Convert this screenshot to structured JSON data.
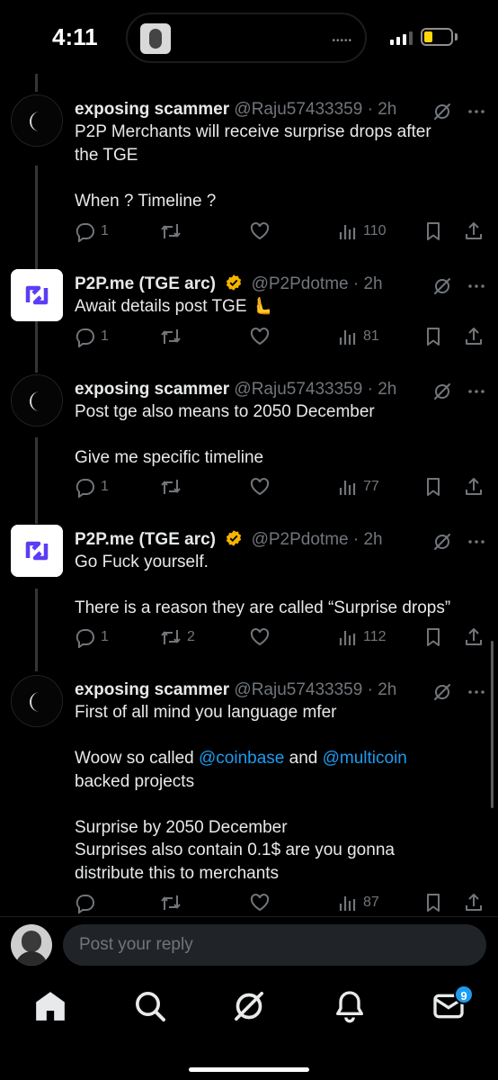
{
  "status_bar": {
    "time": "4:11",
    "island_dots": "•••••"
  },
  "thread": {
    "tweets": [
      {
        "author": "exposing scammer",
        "handle": "@Raju57433359",
        "time": "· 2h",
        "verified": false,
        "avatar": "moon-avatar",
        "lines": [
          "P2P Merchants will receive surprise drops after",
          "the TGE",
          "",
          "When ? Timeline ?"
        ],
        "replies": "1",
        "retweets": "",
        "views": "110"
      },
      {
        "author": "P2P.me (TGE arc)",
        "handle": "@P2Pdotme",
        "time": "· 2h",
        "verified": true,
        "avatar": "p2p-logo",
        "lines": [
          "Await details post TGE 🫷"
        ],
        "replies": "1",
        "retweets": "",
        "views": "81"
      },
      {
        "author": "exposing scammer",
        "handle": "@Raju57433359",
        "time": "· 2h",
        "verified": false,
        "avatar": "moon-avatar",
        "lines": [
          "Post tge also means to 2050 December",
          "",
          "Give me specific timeline"
        ],
        "replies": "1",
        "retweets": "",
        "views": "77"
      },
      {
        "author": "P2P.me (TGE arc)",
        "handle": "@P2Pdotme",
        "time": "· 2h",
        "verified": true,
        "avatar": "p2p-logo",
        "lines": [
          "Go Fuck yourself.",
          "",
          "There is a reason they are called “Surprise drops”"
        ],
        "replies": "1",
        "retweets": "2",
        "views": "112"
      },
      {
        "author": "exposing scammer",
        "handle": "@Raju57433359",
        "time": "· 2h",
        "verified": false,
        "avatar": "moon-avatar",
        "lines_rich": {
          "l1": "First of all mind you language mfer",
          "l2_a": "Woow so called ",
          "l2_link1": "@coinbase",
          "l2_b": " and ",
          "l2_link2": "@multicoin",
          "l3": "backed projects",
          "l4": "Surprise by 2050 December",
          "l5": "Surprises also contain 0.1$ are you gonna",
          "l6": "distribute this to merchants"
        },
        "replies": "",
        "retweets": "",
        "views": "87"
      }
    ]
  },
  "reply_bar": {
    "placeholder": "Post your reply"
  },
  "bottom_nav": {
    "items": [
      "home-icon",
      "search-icon",
      "grok-icon",
      "notifications-icon",
      "messages-icon"
    ],
    "messages_badge": "9"
  },
  "colors": {
    "link": "#1d9bf0",
    "muted": "#71767b",
    "verified": "#f4b400",
    "background": "#000000"
  }
}
